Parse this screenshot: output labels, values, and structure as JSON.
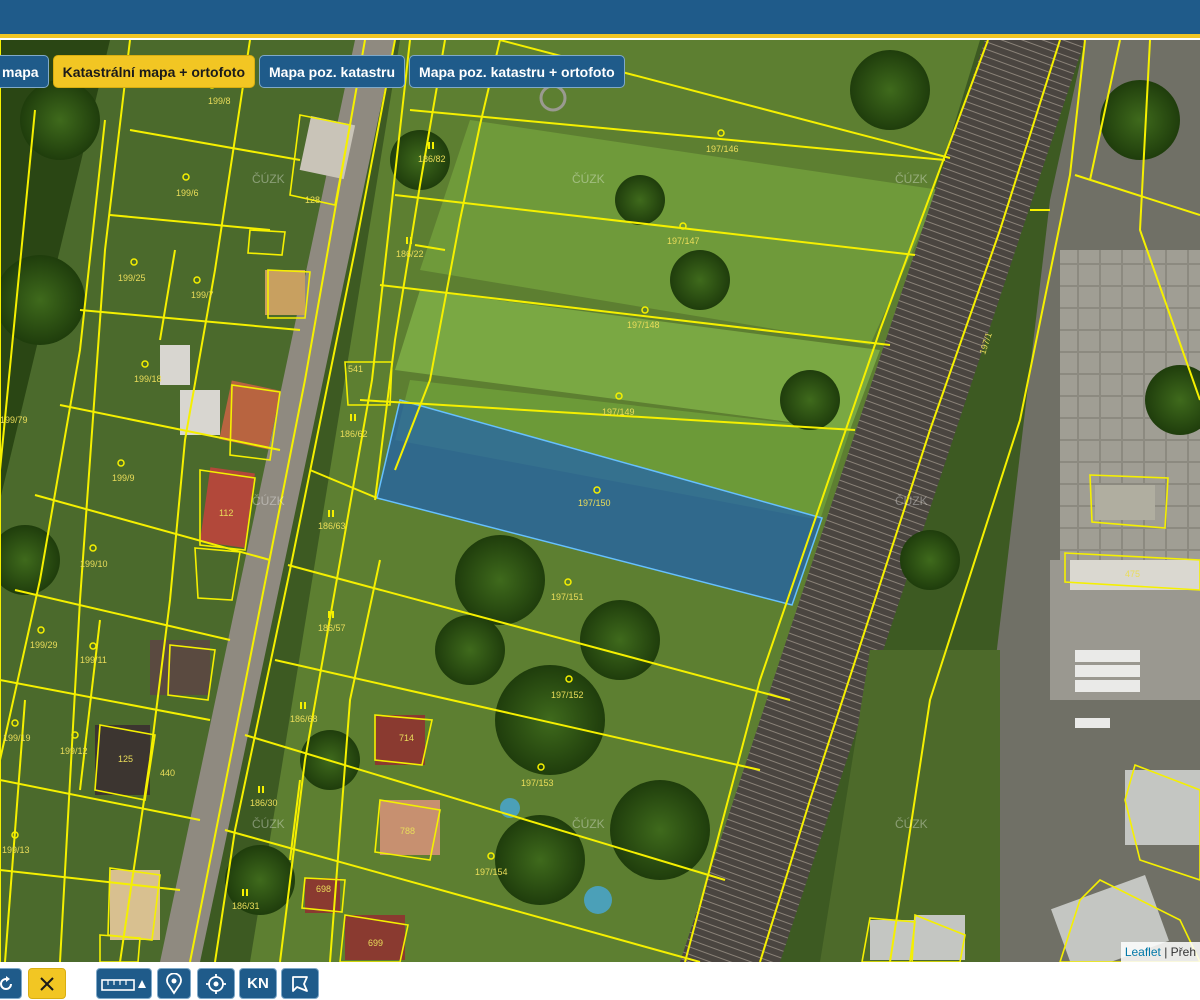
{
  "layer_tabs": [
    {
      "label": "mapa",
      "active": false
    },
    {
      "label": "Katastrální mapa + ortofoto",
      "active": true
    },
    {
      "label": "Mapa poz. katastru",
      "active": false
    },
    {
      "label": "Mapa poz. katastru + ortofoto",
      "active": false
    }
  ],
  "watermark": "ČÚZK",
  "parcels": {
    "p199_8": "199/8",
    "p199_6": "199/6",
    "p199_25": "199/25",
    "p199_7": "199/7",
    "p199_18": "199/18",
    "p199_9": "199/9",
    "p199_10": "199/10",
    "p199_29": "199/29",
    "p199_11": "199/11",
    "p199_19": "199/19",
    "p199_12": "199/12",
    "p199_13": "199/13",
    "p199_79": "199/79",
    "p186_82": "186/82",
    "p186_22": "186/22",
    "p186_62": "186/62",
    "p186_63": "186/63",
    "p186_57": "186/57",
    "p186_68": "186/68",
    "p186_30": "186/30",
    "p186_31": "186/31",
    "p197_146": "197/146",
    "p197_147": "197/147",
    "p197_148": "197/148",
    "p197_149": "197/149",
    "p197_150": "197/150",
    "p197_151": "197/151",
    "p197_152": "197/152",
    "p197_153": "197/153",
    "p197_154": "197/154",
    "p197_1": "197/1",
    "b112": "112",
    "b125": "125",
    "b128": "128",
    "b440": "440",
    "b541": "541",
    "b714": "714",
    "b788": "788",
    "b698": "698",
    "b699": "699",
    "b475": "475"
  },
  "attribution": {
    "leaflet": "Leaflet",
    "rest": "| Přeh"
  },
  "tools": {
    "kn": "KN",
    "refresh_icon": "refresh-icon",
    "close_icon": "close-icon",
    "measure_icon": "ruler-icon",
    "gps_icon": "gps-icon",
    "locate_icon": "crosshair-icon",
    "area_icon": "polygon-icon"
  },
  "colors": {
    "header": "#1f5b8a",
    "accent": "#f2c623",
    "parcel_lines": "#f5f000",
    "selection": "#1e5fb3"
  }
}
